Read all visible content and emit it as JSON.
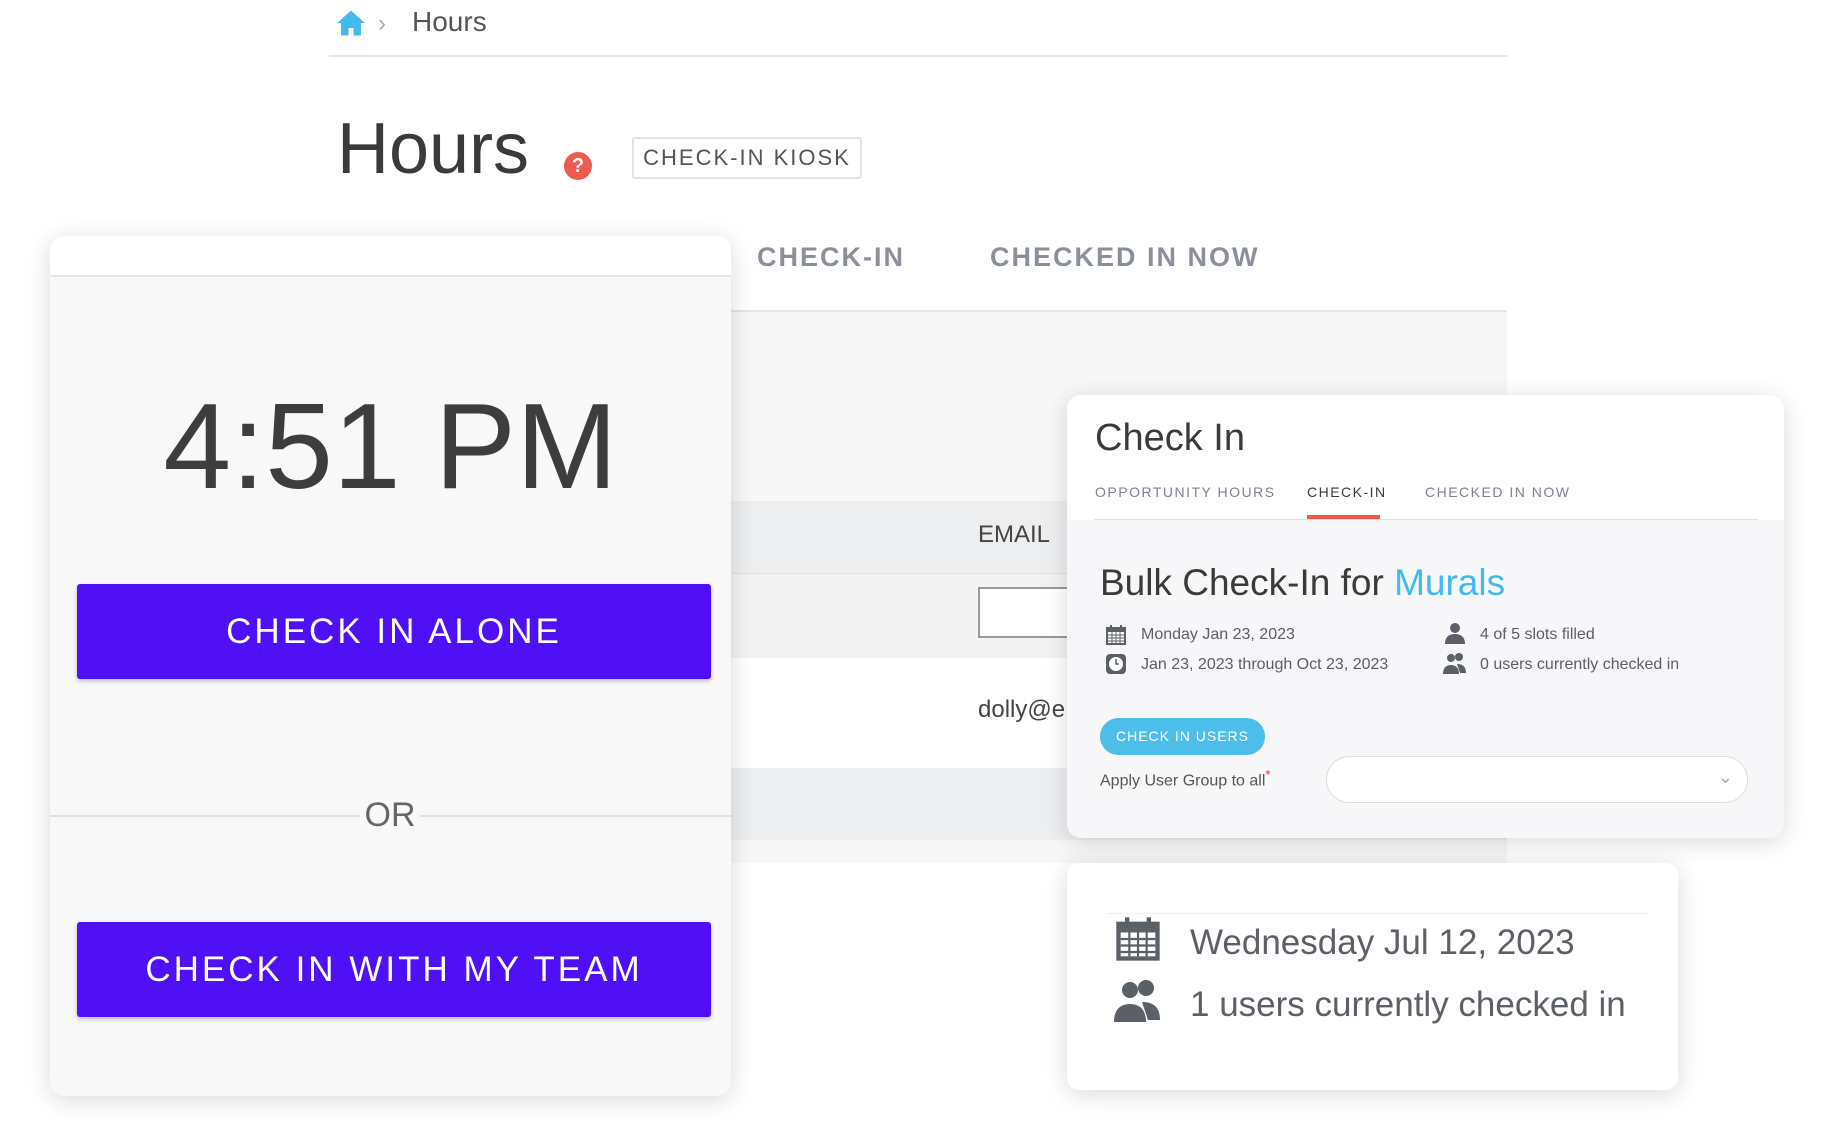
{
  "breadcrumb": {
    "home_icon": "home-icon",
    "separator": "›",
    "current": "Hours"
  },
  "header": {
    "title": "Hours",
    "help_icon": "?",
    "kiosk_button": "CHECK-IN KIOSK"
  },
  "background_tabs": [
    "CHECK-IN",
    "CHECKED IN NOW"
  ],
  "background_table": {
    "column_header": "EMAIL",
    "row_value": "dolly@e"
  },
  "kiosk": {
    "time": "4:51 PM",
    "check_in_alone": "CHECK IN ALONE",
    "or": "OR",
    "check_in_team": "CHECK IN WITH MY TEAM",
    "accent": "#5010f5"
  },
  "check_in_panel": {
    "title": "Check In",
    "tabs": [
      {
        "label": "OPPORTUNITY HOURS"
      },
      {
        "label": "CHECK-IN",
        "active": true
      },
      {
        "label": "CHECKED IN NOW"
      }
    ],
    "bulk_title": "Bulk Check-In for ",
    "opportunity": "Murals",
    "date": "Monday Jan 23, 2023",
    "range": "Jan 23, 2023 through Oct 23, 2023",
    "slots": "4 of 5 slots filled",
    "checked_in": "0 users currently checked in",
    "check_in_button": "CHECK IN USERS",
    "apply_label": "Apply User Group to all",
    "required_mark": "*",
    "select_value": ""
  },
  "summary": {
    "date": "Wednesday Jul 12, 2023",
    "checked_in": "1 users currently checked in"
  }
}
